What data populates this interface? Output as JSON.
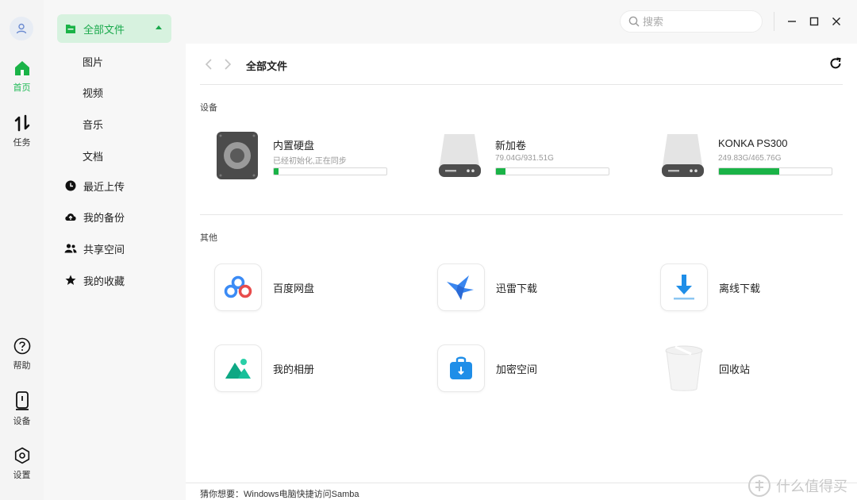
{
  "rail": {
    "items": [
      {
        "label": "首页"
      },
      {
        "label": "任务"
      },
      {
        "label": "帮助"
      },
      {
        "label": "设备"
      },
      {
        "label": "设置"
      }
    ]
  },
  "nav": {
    "all_files": "全部文件",
    "sub": [
      "图片",
      "视频",
      "音乐",
      "文档"
    ],
    "items": [
      "最近上传",
      "我的备份",
      "共享空间",
      "我的收藏"
    ]
  },
  "topbar": {
    "search_placeholder": "搜索"
  },
  "path": {
    "current": "全部文件"
  },
  "devices_section": {
    "title": "设备",
    "items": [
      {
        "name": "内置硬盘",
        "sub": "已经初始化,正在同步",
        "progress": 0.04
      },
      {
        "name": "新加卷",
        "sub": "79.04G/931.51G",
        "progress": 0.085
      },
      {
        "name": "KONKA PS300",
        "sub": "249.83G/465.76G",
        "progress": 0.536
      }
    ]
  },
  "other_section": {
    "title": "其他",
    "items": [
      "百度网盘",
      "迅雷下载",
      "离线下载",
      "我的相册",
      "加密空间",
      "回收站"
    ]
  },
  "footer": {
    "tip": "猜你想要：Windows电脑快捷访问Samba",
    "watermark": "什么值得买"
  },
  "colors": {
    "accent": "#1ab347",
    "accent_bg": "#d7f2df"
  }
}
